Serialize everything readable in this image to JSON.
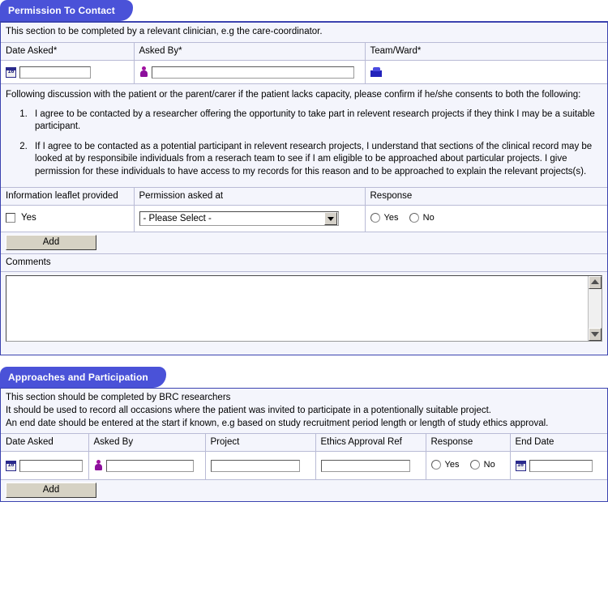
{
  "section1": {
    "tab_label": "Permission To Contact",
    "note": "This section to be completed by a relevant clinician, e.g the care-coordinator.",
    "asked_table": {
      "headers": [
        "Date Asked*",
        "Asked By*",
        "Team/Ward*"
      ],
      "values": {
        "date_asked": "",
        "asked_by": "",
        "team_ward": ""
      },
      "icons": [
        "calendar-icon",
        "person-icon",
        "ward-icon"
      ]
    },
    "intro": "Following discussion with the patient or the parent/carer if the patient lacks capacity, please confirm if he/she consents to both the following:",
    "terms": [
      "I agree to be contacted by a researcher offering the opportunity to take part in relevent research projects if they think I may be a suitable participant.",
      "If I agree to be contacted as a potential participant in relevent research projects, I understand that sections of the clinical record may be looked at by responsibile individuals from a reserach team to see if I am eligible to be approached about particular projects. I give permission for these individuals to have access to my records for this reason and to be approached to explain the relevant projects(s)."
    ],
    "permission_table": {
      "headers": [
        "Information leaflet provided",
        "Permission asked at",
        "Response"
      ],
      "leaflet_checkbox_label": "Yes",
      "leaflet_checked": false,
      "permission_select": {
        "selected": "- Please Select -",
        "options": [
          "- Please Select -"
        ]
      },
      "response": {
        "yes_label": "Yes",
        "no_label": "No",
        "selected": ""
      }
    },
    "add_button": "Add",
    "comments_label": "Comments",
    "comments_value": ""
  },
  "section2": {
    "tab_label": "Approaches and Participation",
    "notes": [
      "This section should be completed by BRC researchers",
      "It should be used to record all occasions where the patient was invited to participate in a potentionally suitable project.",
      "An end date should be entered at the start if known, e.g based on study recruitment period length or length of study ethics approval."
    ],
    "table": {
      "headers": [
        "Date Asked",
        "Asked By",
        "Project",
        "Ethics Approval Ref",
        "Response",
        "End Date"
      ],
      "values": {
        "date_asked": "",
        "asked_by": "",
        "project": "",
        "ethics_ref": "",
        "end_date": ""
      },
      "response": {
        "yes_label": "Yes",
        "no_label": "No",
        "selected": ""
      }
    },
    "add_button": "Add"
  },
  "colors": {
    "tab_blue": "#4a52d8",
    "panel_border": "#3b43b0",
    "panel_bg": "#f4f5fc",
    "grid_line": "#b9bbd6"
  }
}
